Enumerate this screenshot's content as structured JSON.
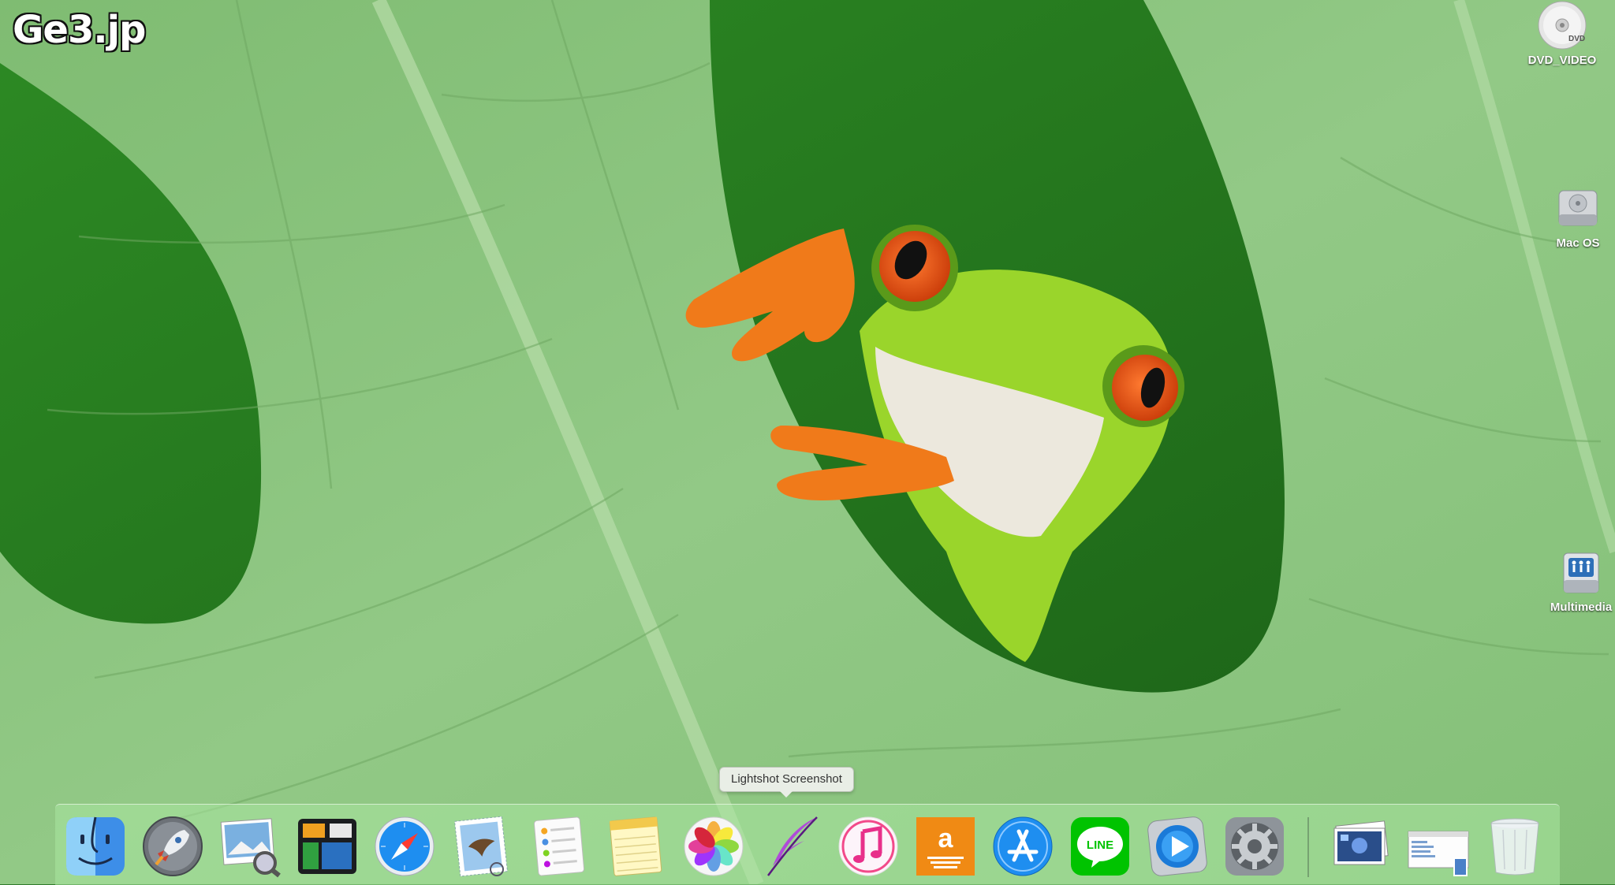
{
  "watermark": "Ge3.jp",
  "desktop_icons": [
    {
      "label": "DVD_VIDEO",
      "icon": "dvd-disc-icon"
    },
    {
      "label": "Mac OS",
      "icon": "hard-drive-icon"
    },
    {
      "label": "Multimedia",
      "icon": "network-drive-icon"
    }
  ],
  "tooltip": "Lightshot Screenshot",
  "dock": {
    "apps": [
      {
        "name": "finder-icon"
      },
      {
        "name": "launchpad-rocket-icon"
      },
      {
        "name": "preview-photos-icon"
      },
      {
        "name": "mission-control-icon"
      },
      {
        "name": "safari-compass-icon"
      },
      {
        "name": "mail-stamp-eagle-icon"
      },
      {
        "name": "reminders-list-icon"
      },
      {
        "name": "notes-pad-icon"
      },
      {
        "name": "photos-flower-icon"
      },
      {
        "name": "lightshot-feather-icon"
      },
      {
        "name": "itunes-music-note-icon"
      },
      {
        "name": "amazon-music-icon",
        "text": "a"
      },
      {
        "name": "app-store-icon"
      },
      {
        "name": "line-app-icon",
        "text": "LINE"
      },
      {
        "name": "quicktime-play-icon"
      },
      {
        "name": "system-preferences-gear-icon"
      }
    ],
    "stacks": [
      {
        "name": "image-stack-icon"
      },
      {
        "name": "screenshot-window-icon"
      },
      {
        "name": "trash-icon"
      }
    ]
  },
  "colors": {
    "wallpaper_leaf": "#8cc57d",
    "wallpaper_dark": "#1f6b1c",
    "frog_green": "#9ad52b",
    "frog_eye": "#e8501a",
    "dock_bg": "#aae6a0"
  }
}
